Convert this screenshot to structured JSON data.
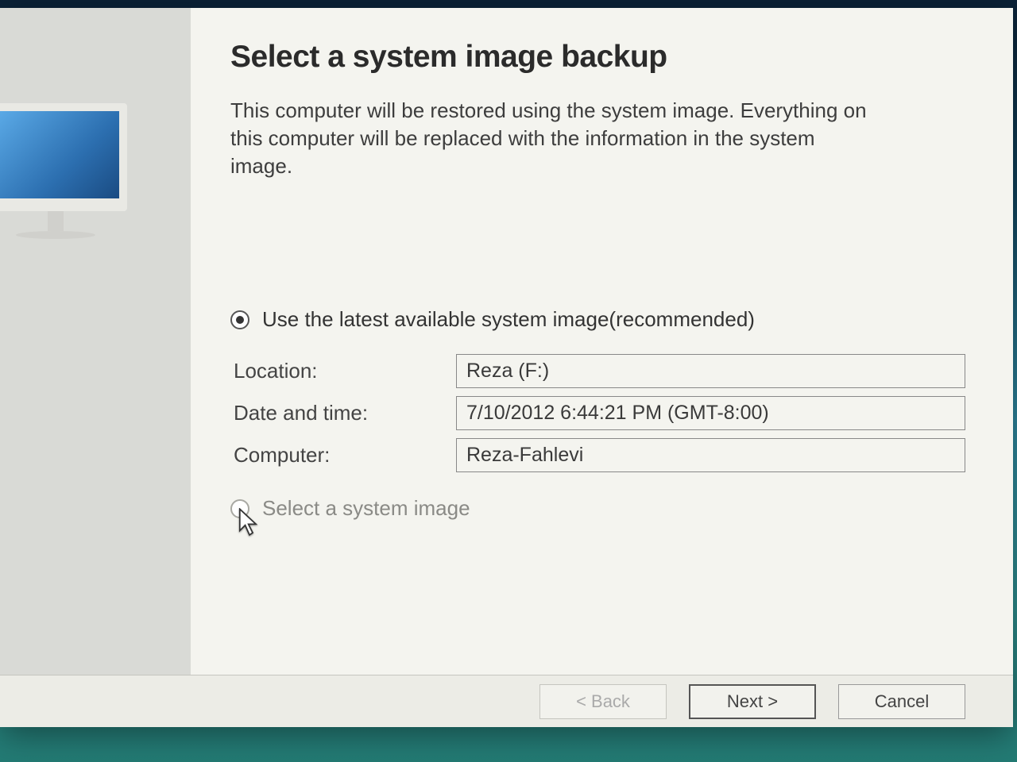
{
  "dialog": {
    "title": "Select a system image backup",
    "description": "This computer will be restored using the system image. Everything on this computer will be replaced with the information in the system image.",
    "options": {
      "use_latest": {
        "label": "Use the latest available system image(recommended)",
        "selected": true
      },
      "select_image": {
        "label": "Select a system image",
        "selected": false
      }
    },
    "fields": {
      "location": {
        "label": "Location:",
        "value": "Reza (F:)"
      },
      "datetime": {
        "label": "Date and time:",
        "value": "7/10/2012 6:44:21 PM (GMT-8:00)"
      },
      "computer": {
        "label": "Computer:",
        "value": "Reza-Fahlevi"
      }
    },
    "buttons": {
      "back": "< Back",
      "next": "Next >",
      "cancel": "Cancel"
    }
  }
}
